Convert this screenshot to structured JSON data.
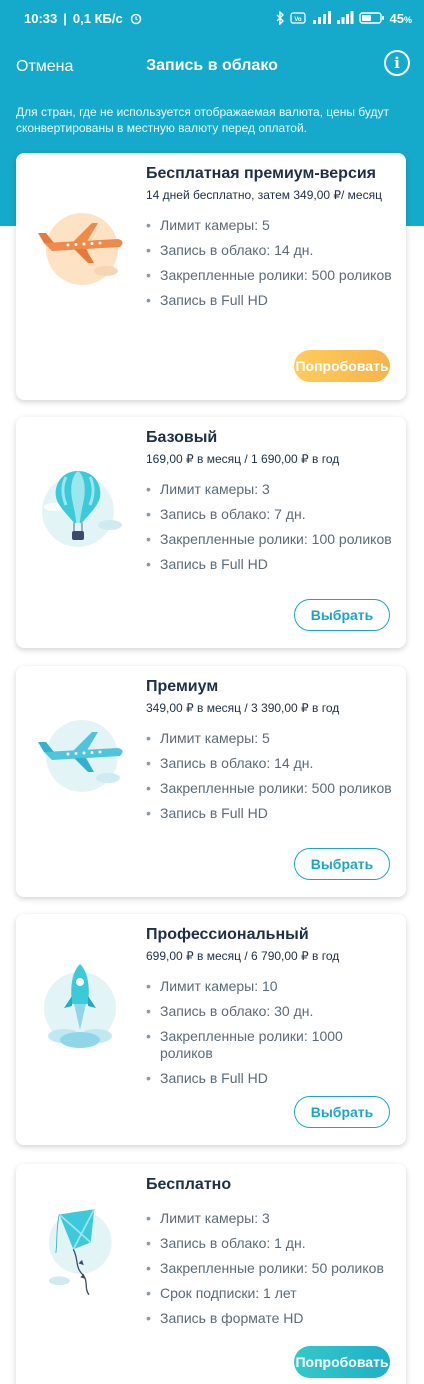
{
  "status_bar": {
    "time": "10:33",
    "speed": "0,1 КБ/с",
    "battery": "45"
  },
  "header": {
    "cancel_label": "Отмена",
    "title": "Запись в облако",
    "info_icon": "info-icon"
  },
  "currency_note": "Для стран, где не используется отображаемая валюта, цены будут сконвертированы в местную валюту перед оплатой.",
  "plans": [
    {
      "name": "Бесплатная премиум-версия",
      "price": "14 дней бесплатно, затем 349,00 ₽/ месяц",
      "features": [
        "Лимит камеры: 5",
        "Запись в облако: 14 дн.",
        "Закрепленные ролики: 500 роликов",
        "Запись в Full HD"
      ],
      "button_label": "Попробовать",
      "icon": "airplane-icon"
    },
    {
      "name": "Базовый",
      "price": "169,00 ₽ в месяц / 1 690,00 ₽ в год",
      "features": [
        "Лимит камеры: 3",
        "Запись в облако: 7 дн.",
        "Закрепленные ролики: 100 роликов",
        "Запись в Full HD"
      ],
      "button_label": "Выбрать",
      "icon": "hot-air-balloon-icon"
    },
    {
      "name": "Премиум",
      "price": "349,00 ₽ в месяц / 3 390,00 ₽ в год",
      "features": [
        "Лимит камеры: 5",
        "Запись в облако: 14 дн.",
        "Закрепленные ролики: 500 роликов",
        "Запись в Full HD"
      ],
      "button_label": "Выбрать",
      "icon": "airplane-icon"
    },
    {
      "name": "Профессиональный",
      "price": "699,00 ₽ в месяц / 6 790,00 ₽ в год",
      "features": [
        "Лимит камеры: 10",
        "Запись в облако: 30 дн.",
        "Закрепленные ролики: 1000 роликов",
        "Запись в Full HD"
      ],
      "button_label": "Выбрать",
      "icon": "rocket-icon"
    },
    {
      "name": "Бесплатно",
      "features": [
        "Лимит камеры: 3",
        "Запись в облако: 1 дн.",
        "Закрепленные ролики: 50 роликов",
        "Срок подписки: 1 лет",
        "Запись в формате HD"
      ],
      "button_label": "Попробовать",
      "icon": "kite-icon"
    }
  ],
  "colors": {
    "header_bg": "#15aacb",
    "accent": "#1aa6c4",
    "try_orange": "#f7b44a",
    "try_teal": "#1db0c8"
  }
}
